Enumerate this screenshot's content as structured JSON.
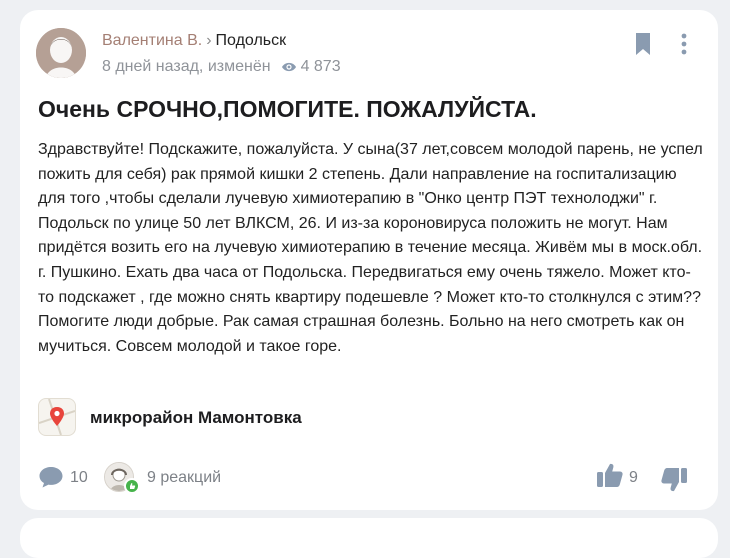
{
  "post": {
    "author_name": "Валентина В.",
    "separator": "›",
    "city": "Подольск",
    "time": "8 дней назад, изменён",
    "views": "4 873",
    "title": "Очень СРОЧНО,ПОМОГИТЕ. ПОЖАЛУЙСТА.",
    "body": "Здравствуйте! Подскажите, пожалуйста. У сына(37 лет,совсем молодой парень, не успел пожить для себя) рак прямой кишки 2 степень. Дали направление на госпитализацию для того ,чтобы сделали лучевую химиотерапию в \"Онко центр ПЭТ технолоджи\" г. Подольск по улице 50 лет ВЛКСМ, 26. И из-за короновируса положить не могут. Нам придётся возить его на лучевую химиотерапию в течение месяца. Живём мы в моск.обл. г. Пушкино. Ехать два часа от Подольска. Передвигаться ему очень тяжело. Может кто-то подскажет , где можно снять квартиру подешевле ? Может кто-то столкнулся с этим?? Помогите люди добрые. Рак самая страшная болезнь. Больно на него смотреть как он мучиться. Совсем молодой и такое горе.",
    "place": "микрорайон Мамонтовка"
  },
  "footer": {
    "comments": "10",
    "reactions": "9 реакций",
    "likes": "9"
  },
  "icons": {
    "views": "eye-icon",
    "bookmark": "bookmark-icon",
    "more": "more-vertical-icon",
    "place": "map-pin-icon",
    "comments": "comment-icon",
    "like": "thumbs-up-icon",
    "dislike": "thumbs-down-icon"
  },
  "colors": {
    "author": "#a47f74",
    "muted": "#8f9399",
    "icon": "#8a9bb0",
    "pin": "#e8453c",
    "reaction_badge": "#46b34b"
  }
}
